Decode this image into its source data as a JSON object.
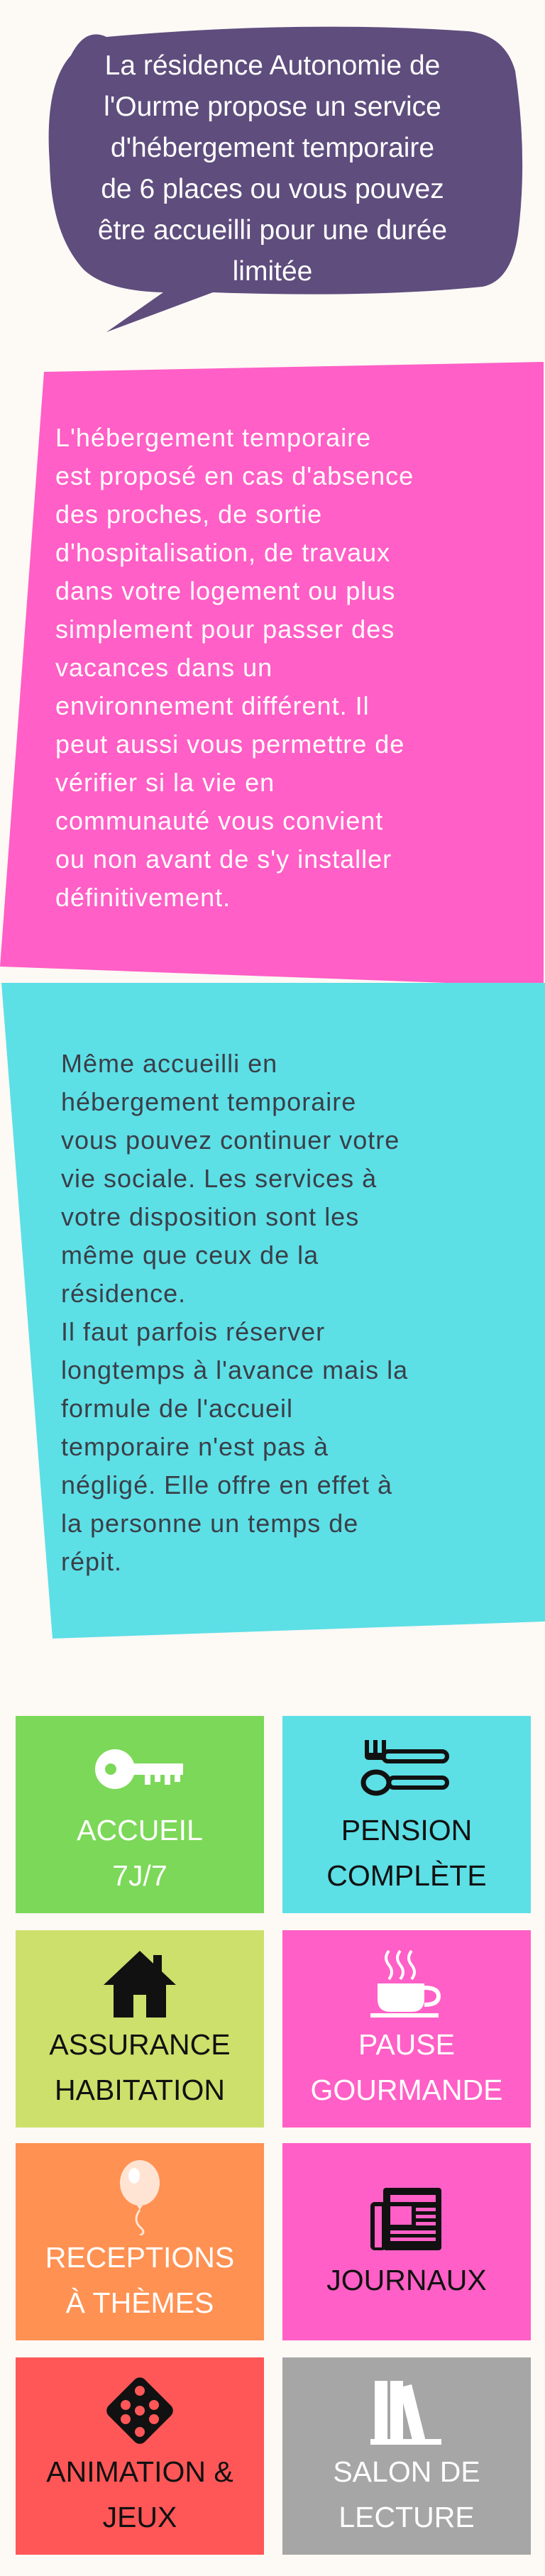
{
  "colors": {
    "background": "#fdf9f5",
    "bubble": "#5e4d7d",
    "pink": "#ff5fc6",
    "cyan": "#5ddfe6",
    "green": "#7cd858",
    "lime": "#cde06b",
    "orange": "#ff9152",
    "red": "#ff5757",
    "gray": "#a6a6a6"
  },
  "intro": {
    "text": "La résidence Autonomie de\nl'Ourme propose un service\nd'hébergement temporaire\nde 6 places ou vous pouvez\nêtre accueilli pour une durée\nlimitée"
  },
  "pink_block": {
    "text": "L'hébergement temporaire\nest proposé en cas d'absence\ndes proches, de sortie\nd'hospitalisation, de travaux\ndans votre logement ou plus\nsimplement pour passer des\nvacances dans un\nenvironnement différent. Il\npeut aussi vous permettre de\nvérifier si la vie en\ncommunauté vous convient\nou non avant de s'y installer\ndéfinitivement."
  },
  "cyan_block": {
    "text": "Même accueilli en\nhébergement temporaire\nvous pouvez continuer votre\nvie sociale. Les services à\nvotre disposition sont les\nmême que ceux de la\nrésidence.\nIl faut parfois réserver\nlongtemps à l'avance mais la\nformule de l'accueil\ntemporaire n'est pas à\nnégligé. Elle offre en effet à\nla personne un temps de\nrépit."
  },
  "services": [
    {
      "label": "ACCUEIL\n7j/7",
      "icon": "key-icon",
      "bg": "#7cd858",
      "fg": "#ffffff"
    },
    {
      "label": "PENSION\nCOMPLÈTE",
      "icon": "cutlery-icon",
      "bg": "#5ddfe6",
      "fg": "#111111"
    },
    {
      "label": "ASSURANCE\nHABITATION",
      "icon": "house-icon",
      "bg": "#cde06b",
      "fg": "#111111"
    },
    {
      "label": "PAUSE\nGOURMANDE",
      "icon": "coffee-cup-icon",
      "bg": "#ff5fc6",
      "fg": "#ffffff"
    },
    {
      "label": "RECEPTIONS\nÀ THÈMES",
      "icon": "balloon-icon",
      "bg": "#ff9152",
      "fg": "#ffffff"
    },
    {
      "label": "JOURNAUX",
      "icon": "newspaper-icon",
      "bg": "#ff5fc6",
      "fg": "#111111"
    },
    {
      "label": "ANIMATION &\nJEUX",
      "icon": "dice-icon",
      "bg": "#ff5757",
      "fg": "#111111"
    },
    {
      "label": "SALON DE\nLECTURE",
      "icon": "books-icon",
      "bg": "#a6a6a6",
      "fg": "#ffffff"
    }
  ]
}
